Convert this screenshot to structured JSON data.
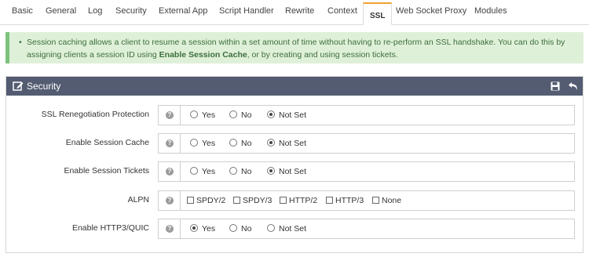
{
  "tabs": [
    {
      "label": "Basic"
    },
    {
      "label": "General"
    },
    {
      "label": "Log"
    },
    {
      "label": "Security"
    },
    {
      "label": "External App"
    },
    {
      "label": "Script Handler"
    },
    {
      "label": "Rewrite"
    },
    {
      "label": "Context"
    },
    {
      "label": "SSL"
    },
    {
      "label": "Web Socket Proxy"
    },
    {
      "label": "Modules"
    }
  ],
  "active_tab": "SSL",
  "banner": {
    "bullet": "•",
    "text_part1": "Session caching allows a client to resume a session within a set amount of time without having to re-perform an SSL handshake. You can do this by assigning clients a session ID using ",
    "bold": "Enable Session Cache",
    "text_part2": ", or by creating and using session tickets."
  },
  "panel": {
    "title": "Security",
    "help_glyph": "?",
    "rows": [
      {
        "label": "SSL Renegotiation Protection",
        "type": "radio",
        "options": [
          "Yes",
          "No",
          "Not Set"
        ],
        "selected": "Not Set"
      },
      {
        "label": "Enable Session Cache",
        "type": "radio",
        "options": [
          "Yes",
          "No",
          "Not Set"
        ],
        "selected": "Not Set"
      },
      {
        "label": "Enable Session Tickets",
        "type": "radio",
        "options": [
          "Yes",
          "No",
          "Not Set"
        ],
        "selected": "Not Set"
      },
      {
        "label": "ALPN",
        "type": "checkbox",
        "options": [
          "SPDY/2",
          "SPDY/3",
          "HTTP/2",
          "HTTP/3",
          "None"
        ],
        "checked": []
      },
      {
        "label": "Enable HTTP3/QUIC",
        "type": "radio",
        "options": [
          "Yes",
          "No",
          "Not Set"
        ],
        "selected": "Yes"
      }
    ]
  },
  "colors": {
    "panel_header": "#535c71",
    "banner_bg": "#dff0d8",
    "banner_border": "#7dc27d",
    "active_tab_accent": "#f0a030"
  }
}
